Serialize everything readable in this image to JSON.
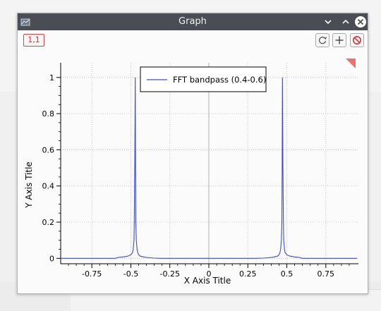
{
  "window": {
    "title": "Graph",
    "cell_label": "1,1"
  },
  "icons": {
    "app": "app-icon",
    "minimize": "chevron-down-icon",
    "maximize": "chevron-up-icon",
    "close": "close-icon",
    "refresh": "refresh-icon",
    "add": "plus-icon",
    "clear": "no-entry-icon"
  },
  "colors": {
    "titlebar": "#4a4e54",
    "series": "#3a48e0",
    "badge": "#d83030",
    "corner_marker": "#f07070"
  },
  "chart_data": {
    "type": "line",
    "title": "",
    "xlabel": "X Axis Title",
    "ylabel": "Y Axis Title",
    "xlim": [
      -0.95,
      0.95
    ],
    "ylim": [
      -0.03,
      1.05
    ],
    "xticks": [
      -0.75,
      -0.5,
      -0.25,
      0,
      0.25,
      0.5,
      0.75
    ],
    "xtick_labels": [
      "-0.75",
      "-0.5",
      "-0.25",
      "0",
      "0.25",
      "0.5",
      "0.75"
    ],
    "yticks": [
      0,
      0.2,
      0.4,
      0.6,
      0.8,
      1
    ],
    "ytick_labels": [
      "0",
      "0.2",
      "0.4",
      "0.6",
      "0.8",
      "1"
    ],
    "grid": true,
    "legend": "top-center",
    "series": [
      {
        "name": "FFT bandpass (0.4-0.6)",
        "x": [
          -0.95,
          -0.6,
          -0.58,
          -0.55,
          -0.52,
          -0.5,
          -0.49,
          -0.485,
          -0.48,
          -0.478,
          -0.475,
          -0.472,
          -0.47,
          -0.468,
          -0.465,
          -0.46,
          -0.455,
          -0.45,
          -0.44,
          -0.42,
          -0.4,
          -0.38,
          -0.35,
          -0.3,
          0,
          0.3,
          0.35,
          0.38,
          0.4,
          0.42,
          0.44,
          0.45,
          0.455,
          0.46,
          0.465,
          0.468,
          0.47,
          0.472,
          0.475,
          0.478,
          0.48,
          0.485,
          0.49,
          0.5,
          0.52,
          0.55,
          0.58,
          0.6,
          0.95
        ],
        "y": [
          0,
          0,
          0.005,
          0.008,
          0.012,
          0.02,
          0.03,
          0.05,
          0.1,
          0.2,
          0.5,
          1.0,
          0.5,
          0.2,
          0.1,
          0.05,
          0.03,
          0.02,
          0.012,
          0.008,
          0.005,
          0.003,
          0.001,
          0,
          0,
          0,
          0.001,
          0.003,
          0.005,
          0.008,
          0.012,
          0.02,
          0.03,
          0.05,
          0.1,
          0.2,
          0.5,
          1.0,
          0.5,
          0.2,
          0.1,
          0.05,
          0.03,
          0.02,
          0.012,
          0.008,
          0.005,
          0,
          0
        ]
      }
    ]
  }
}
